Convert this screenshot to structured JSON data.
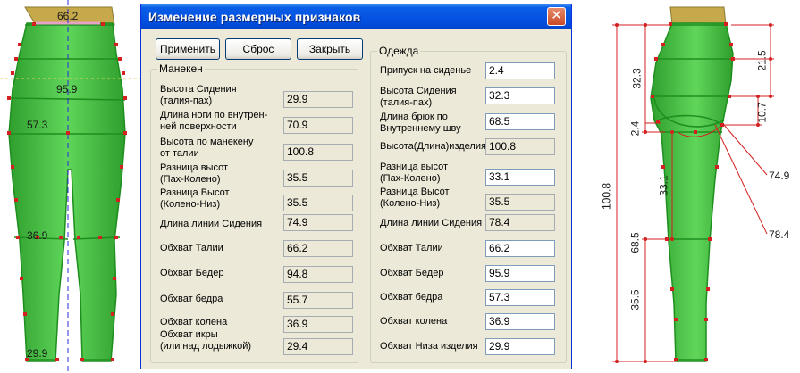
{
  "dialog": {
    "title": "Изменение размерных признаков",
    "close_glyph": "✕",
    "buttons": {
      "apply": "Применить",
      "reset": "Сброс",
      "close": "Закрыть"
    }
  },
  "mannequin": {
    "title": "Манекен",
    "rows": [
      {
        "label": "Высота Сидения\n(талия-пах)",
        "value": "29.9"
      },
      {
        "label": "Длина ноги по внутрен-\nней поверхности",
        "value": "70.9"
      },
      {
        "label": "Высота по манекену\nот талии",
        "value": "100.8"
      },
      {
        "label": "Разница высот\n(Пах-Колено)",
        "value": "35.5"
      },
      {
        "label": "Разница Высот\n(Колено-Низ)",
        "value": "35.5"
      },
      {
        "label": "Длина линии Сидения",
        "value": "74.9"
      },
      {
        "label": "Обхват Талии",
        "value": "66.2"
      },
      {
        "label": "Обхват Бедер",
        "value": "94.8"
      },
      {
        "label": "Обхват бедра",
        "value": "55.7"
      },
      {
        "label": "Обхват колена",
        "value": "36.9"
      },
      {
        "label": "Обхват икры\n(или над лодыжкой)",
        "value": "29.4"
      }
    ]
  },
  "garment": {
    "title": "Одежда",
    "rows": [
      {
        "label": "Припуск на сиденье",
        "value": "2.4"
      },
      {
        "label": "Высота Сидения\n(талия-пах)",
        "value": "32.3"
      },
      {
        "label": "Длина брюк по\nВнутреннему шву",
        "value": "68.5"
      },
      {
        "label": "Высота(Длина)изделия",
        "value": "100.8"
      },
      {
        "label": "Разница высот\n(Пах-Колено)",
        "value": "33.1"
      },
      {
        "label": "Разница Высот\n(Колено-Низ)",
        "value": "35.5"
      },
      {
        "label": "Длина линии Сидения",
        "value": "78.4"
      },
      {
        "label": "Обхват Талии",
        "value": "66.2"
      },
      {
        "label": "Обхват Бедер",
        "value": "95.9"
      },
      {
        "label": "Обхват бедра",
        "value": "57.3"
      },
      {
        "label": "Обхват колена",
        "value": "36.9"
      },
      {
        "label": "Обхват Низа изделия",
        "value": "29.9"
      }
    ]
  },
  "front_view": {
    "labels": {
      "waist": "66.2",
      "hip": "95.9",
      "thigh": "57.3",
      "knee": "36.9",
      "hem": "29.9"
    }
  },
  "side_view": {
    "labels": {
      "total": "100.8",
      "rise": "32.3",
      "allowance": "2.4",
      "knee_gap": "33.1",
      "hem_gap": "35.5",
      "inseam": "68.5",
      "waist_hip": "21.5",
      "hip_seat": "10.7",
      "seat_mannequin": "74.9",
      "seat_garment": "78.4"
    }
  },
  "colors": {
    "garment": "#3dbb3a",
    "outline": "#1e8e1e",
    "dimension": "#d42020",
    "title_bar": "#0554e3"
  }
}
